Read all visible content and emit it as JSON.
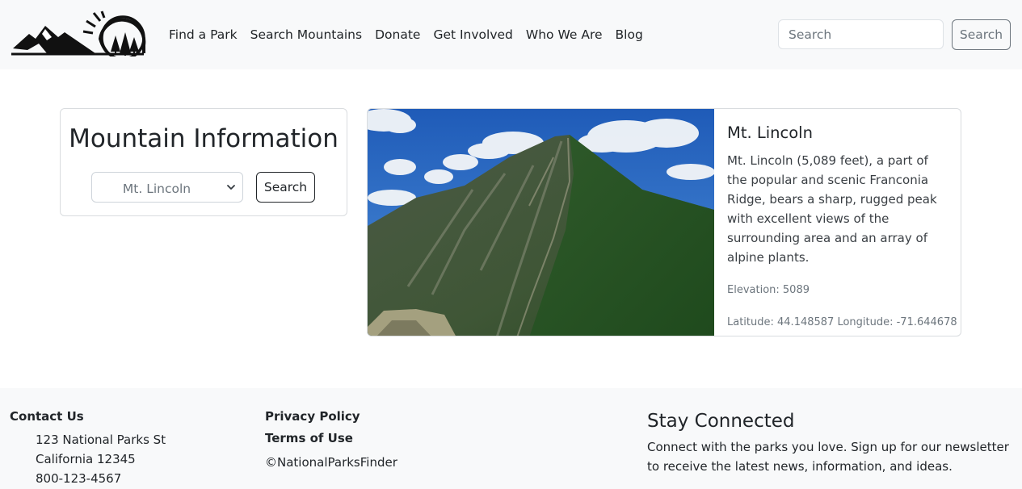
{
  "nav": {
    "links": [
      "Find a Park",
      "Search Mountains",
      "Donate",
      "Get Involved",
      "Who We Are",
      "Blog"
    ],
    "search_placeholder": "Search",
    "search_button": "Search",
    "logo_icon": "mountain-sun-trees-logo"
  },
  "info_card": {
    "title": "Mountain Information",
    "selected_mountain": "Mt. Lincoln",
    "search_button": "Search"
  },
  "mountain": {
    "name": "Mt. Lincoln",
    "description": "Mt. Lincoln (5,089 feet), a part of the popular and scenic Franconia Ridge, bears a sharp, rugged peak with excellent views of the surrounding area and an array of alpine plants.",
    "elevation": "Elevation: 5089",
    "coordinates": "Latitude: 44.148587 Longitude: -71.644678",
    "photo_icon": "mountain-photo"
  },
  "footer": {
    "contact_heading": "Contact Us",
    "address_line1": "123 National Parks St",
    "address_line2": "California 12345",
    "phone": "800-123-4567",
    "privacy": "Privacy Policy",
    "terms": "Terms of Use",
    "copyright": "©NationalParksFinder",
    "stay_title": "Stay Connected",
    "stay_text": "Connect with the parks you love. Sign up for our newsletter to receive the latest news, information, and ideas."
  },
  "colors": {
    "navbar_bg": "#f8f9fa",
    "footer_bg": "#f8f9fa",
    "border": "#dee2e6",
    "muted": "#6c757d"
  }
}
